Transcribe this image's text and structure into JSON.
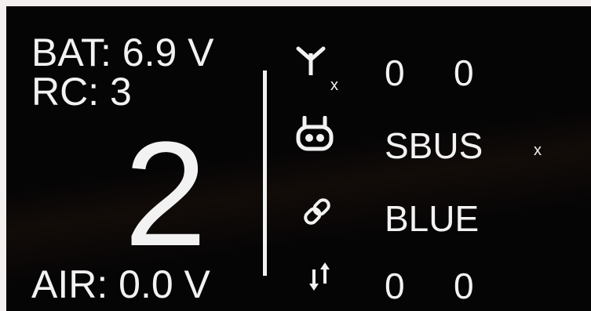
{
  "left_panel": {
    "battery": "BAT: 6.9 V",
    "rc": "RC: 3",
    "model_number": "2",
    "air": "AIR: 0.0 V"
  },
  "status_rows": {
    "antenna": {
      "icon": "antenna-icon",
      "mark": "x",
      "value_a": "0",
      "value_b": "0"
    },
    "protocol": {
      "icon": "receiver-icon",
      "value": "SBUS",
      "mark": "x"
    },
    "link": {
      "icon": "link-icon",
      "value": "BLUE"
    },
    "transfer": {
      "icon": "transfer-arrows-icon",
      "value_a": "0",
      "value_b": "0"
    }
  },
  "colors": {
    "background": "#060505",
    "foreground": "#f2f2f2"
  }
}
